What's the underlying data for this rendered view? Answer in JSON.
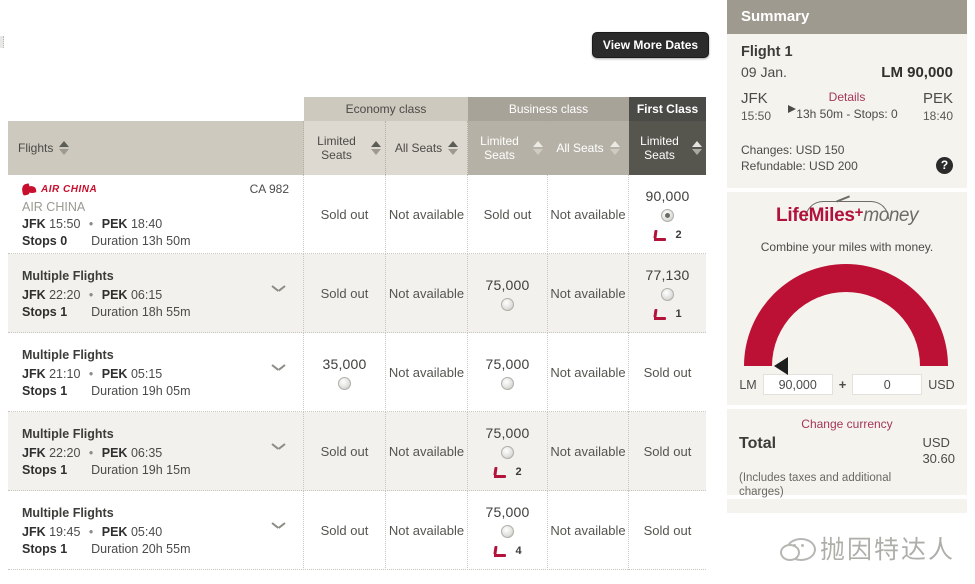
{
  "toolbar": {
    "view_more_dates": "View More Dates"
  },
  "table": {
    "class_groups": [
      {
        "label": "Economy class"
      },
      {
        "label": "Business class"
      },
      {
        "label": "First Class"
      }
    ],
    "columns": {
      "flights": "Flights",
      "economy_limited": "Limited Seats",
      "economy_all": "All Seats",
      "business_limited": "Limited Seats",
      "business_all": "All Seats",
      "first_limited": "Limited Seats"
    },
    "rows": [
      {
        "airline_logo_text": "AIR CHINA",
        "carrier": "AIR CHINA",
        "flight_number": "CA 982",
        "origin": "JFK",
        "depart": "15:50",
        "destination": "PEK",
        "arrive": "18:40",
        "stops": "Stops 0",
        "duration": "Duration 13h 50m",
        "expandable": false,
        "fares": [
          {
            "text": "Sold out",
            "price": null,
            "radio": false,
            "selected": false,
            "seats": null
          },
          {
            "text": "Not available",
            "price": null,
            "radio": false,
            "selected": false,
            "seats": null
          },
          {
            "text": "Sold out",
            "price": null,
            "radio": false,
            "selected": false,
            "seats": null
          },
          {
            "text": "Not available",
            "price": null,
            "radio": false,
            "selected": false,
            "seats": null
          },
          {
            "text": null,
            "price": "90,000",
            "radio": true,
            "selected": true,
            "seats": "2"
          }
        ]
      },
      {
        "airline_logo_text": null,
        "carrier": null,
        "flight_number": null,
        "title": "Multiple Flights",
        "origin": "JFK",
        "depart": "22:20",
        "destination": "PEK",
        "arrive": "06:15",
        "stops": "Stops 1",
        "duration": "Duration 18h 55m",
        "expandable": true,
        "fares": [
          {
            "text": "Sold out",
            "price": null,
            "radio": false,
            "selected": false,
            "seats": null
          },
          {
            "text": "Not available",
            "price": null,
            "radio": false,
            "selected": false,
            "seats": null
          },
          {
            "text": null,
            "price": "75,000",
            "radio": true,
            "selected": false,
            "seats": null
          },
          {
            "text": "Not available",
            "price": null,
            "radio": false,
            "selected": false,
            "seats": null
          },
          {
            "text": null,
            "price": "77,130",
            "radio": true,
            "selected": false,
            "seats": "1"
          }
        ]
      },
      {
        "title": "Multiple Flights",
        "origin": "JFK",
        "depart": "21:10",
        "destination": "PEK",
        "arrive": "05:15",
        "stops": "Stops 1",
        "duration": "Duration 19h 05m",
        "expandable": true,
        "fares": [
          {
            "text": null,
            "price": "35,000",
            "radio": true,
            "selected": false,
            "seats": null
          },
          {
            "text": "Not available",
            "price": null,
            "radio": false,
            "selected": false,
            "seats": null
          },
          {
            "text": null,
            "price": "75,000",
            "radio": true,
            "selected": false,
            "seats": null
          },
          {
            "text": "Not available",
            "price": null,
            "radio": false,
            "selected": false,
            "seats": null
          },
          {
            "text": "Sold out",
            "price": null,
            "radio": false,
            "selected": false,
            "seats": null
          }
        ]
      },
      {
        "title": "Multiple Flights",
        "origin": "JFK",
        "depart": "22:20",
        "destination": "PEK",
        "arrive": "06:35",
        "stops": "Stops 1",
        "duration": "Duration 19h 15m",
        "expandable": true,
        "fares": [
          {
            "text": "Sold out",
            "price": null,
            "radio": false,
            "selected": false,
            "seats": null
          },
          {
            "text": "Not available",
            "price": null,
            "radio": false,
            "selected": false,
            "seats": null
          },
          {
            "text": null,
            "price": "75,000",
            "radio": true,
            "selected": false,
            "seats": "2"
          },
          {
            "text": "Not available",
            "price": null,
            "radio": false,
            "selected": false,
            "seats": null
          },
          {
            "text": "Sold out",
            "price": null,
            "radio": false,
            "selected": false,
            "seats": null
          }
        ]
      },
      {
        "title": "Multiple Flights",
        "origin": "JFK",
        "depart": "19:45",
        "destination": "PEK",
        "arrive": "05:40",
        "stops": "Stops 1",
        "duration": "Duration 20h 55m",
        "expandable": true,
        "fares": [
          {
            "text": "Sold out",
            "price": null,
            "radio": false,
            "selected": false,
            "seats": null
          },
          {
            "text": "Not available",
            "price": null,
            "radio": false,
            "selected": false,
            "seats": null
          },
          {
            "text": null,
            "price": "75,000",
            "radio": true,
            "selected": false,
            "seats": "4"
          },
          {
            "text": "Not available",
            "price": null,
            "radio": false,
            "selected": false,
            "seats": null
          },
          {
            "text": "Sold out",
            "price": null,
            "radio": false,
            "selected": false,
            "seats": null
          }
        ]
      }
    ]
  },
  "summary": {
    "header": "Summary",
    "flight_title": "Flight 1",
    "date": "09 Jan.",
    "miles": "LM 90,000",
    "origin": "JFK",
    "depart": "15:50",
    "destination": "PEK",
    "arrive": "18:40",
    "details_link": "Details",
    "duration_stops": "13h 50m - Stops: 0",
    "changes": "Changes: USD 150",
    "refundable": "Refundable: USD 200",
    "help_icon": "?"
  },
  "lifemiles_money": {
    "logo_life": "LifeMiles",
    "logo_plus": "+",
    "logo_money": "money",
    "tagline": "Combine your miles with money.",
    "miles_label": "LM",
    "miles_value": "90,000",
    "plus_sign": "+",
    "cash_value": "0",
    "cash_label": "USD"
  },
  "total": {
    "change_currency": "Change currency",
    "label": "Total",
    "currency": "USD",
    "amount": "30.60",
    "note": "(Includes taxes and additional charges)"
  },
  "watermark": {
    "text": "抛因特达人"
  },
  "colors": {
    "brand_red": "#bc1134",
    "link_red": "#a4365a",
    "header_tan": "#cdc9be",
    "header_dark": "#4a4a47",
    "panel_bg": "#f4f3ee"
  }
}
